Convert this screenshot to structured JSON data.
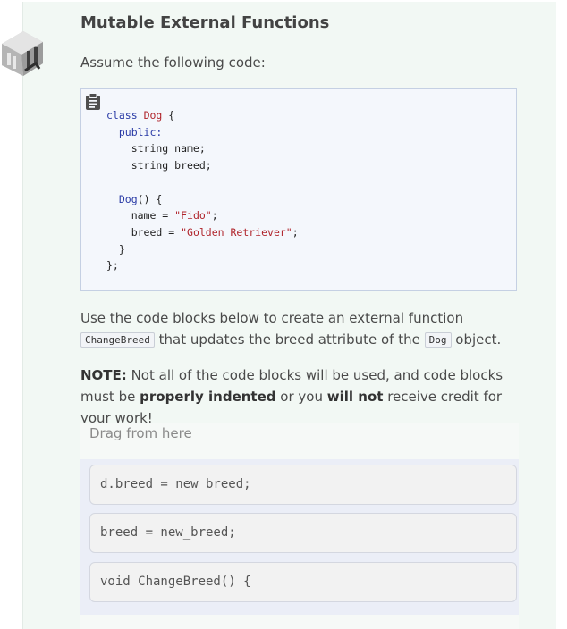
{
  "title": "Mutable External Functions",
  "intro": "Assume the following code:",
  "code_lines": [
    "class Dog {",
    "  public:",
    "    string name;",
    "    string breed;",
    "",
    "  Dog() {",
    "    name = \"Fido\";",
    "    breed = \"Golden Retriever\";",
    "  }",
    "};"
  ],
  "instructions": {
    "before": "Use the code blocks below to create an external function",
    "code1": "ChangeBreed",
    "middle": "that updates the breed attribute of the",
    "code2": "Dog",
    "after": "object."
  },
  "note": {
    "label": "NOTE:",
    "text1": "Not all of the code blocks will be used, and code blocks must be",
    "bold1": "properly indented",
    "text2": "or you",
    "bold2": "will not",
    "text3": "receive credit for your work!"
  },
  "drag": {
    "label": "Drag from here",
    "blocks": [
      "d.breed = new_breed;",
      "breed = new_breed;",
      "void ChangeBreed() {"
    ]
  },
  "icons": {
    "logo": "codio-robot-logo-icon",
    "copy": "clipboard-icon"
  },
  "colors": {
    "keyword": "#2a3ba6",
    "string": "#b0242b",
    "card_bg": "#f2f8f4"
  }
}
